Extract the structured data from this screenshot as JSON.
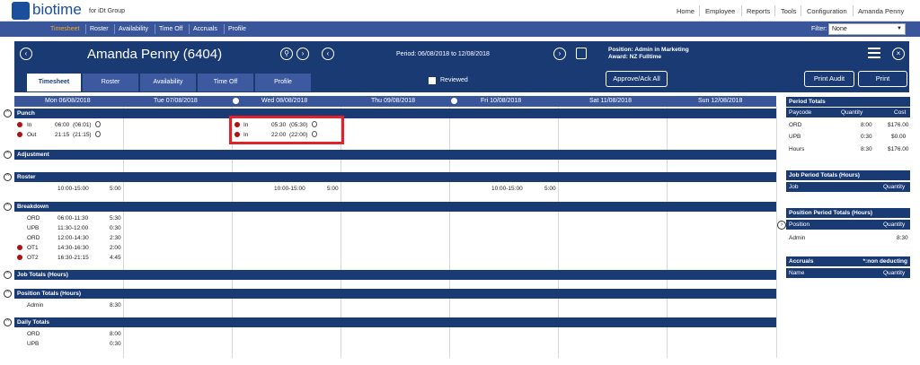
{
  "app": {
    "logo": "biotime",
    "subtitle": "for iDt Group"
  },
  "topnav": [
    "Home",
    "Employee",
    "Reports",
    "Tools",
    "Configuration",
    "Amanda Penny"
  ],
  "menu": [
    "Timesheet",
    "Roster",
    "Availability",
    "Time Off",
    "Accruals",
    "Profile"
  ],
  "filter": {
    "label": "Filter:",
    "value": "None"
  },
  "employee": {
    "name": "Amanda Penny (6404)",
    "period": "Period: 06/08/2018 to 12/08/2018",
    "position": "Position: Admin in Marketing",
    "award": "Award: NZ Fulltime"
  },
  "tabs": [
    "Timesheet",
    "Roster",
    "Availability",
    "Time Off",
    "Profile"
  ],
  "reviewed": "Reviewed",
  "buttons": {
    "approve": "Approve/Ack All",
    "print_audit": "Print Audit",
    "print": "Print"
  },
  "days": [
    "Mon 06/08/2018",
    "Tue 07/08/2018",
    "Wed 08/08/2018",
    "Thu 09/08/2018",
    "Fri 10/08/2018",
    "Sat 11/08/2018",
    "Sun 12/08/2018"
  ],
  "sections": {
    "punch": "Punch",
    "adjustment": "Adjustment",
    "roster": "Roster",
    "breakdown": "Breakdown",
    "job_totals": "Job Totals (Hours)",
    "position_totals": "Position Totals (Hours)",
    "daily_totals": "Daily Totals"
  },
  "punch": {
    "mon": [
      {
        "type": "In",
        "time": "06:00",
        "rounded": "(06:01)"
      },
      {
        "type": "Out",
        "time": "21:15",
        "rounded": "(21:15)"
      }
    ],
    "wed": [
      {
        "type": "In",
        "time": "05:30",
        "rounded": "(05:30)"
      },
      {
        "type": "In",
        "time": "22:00",
        "rounded": "(22:00)"
      }
    ]
  },
  "roster": [
    {
      "range": "10:00-15:00",
      "hours": "5:00"
    },
    {
      "range": "10:00-15:00",
      "hours": "5:00"
    },
    {
      "range": "10:00-15:00",
      "hours": "5:00"
    }
  ],
  "breakdown": [
    {
      "code": "ORD",
      "range": "06:00-11:30",
      "hours": "5:30"
    },
    {
      "code": "UPB",
      "range": "11:30-12:00",
      "hours": "0:30"
    },
    {
      "code": "ORD",
      "range": "12:00-14:30",
      "hours": "2:30"
    },
    {
      "code": "OT1",
      "range": "14:30-16:30",
      "hours": "2:00"
    },
    {
      "code": "OT2",
      "range": "16:30-21:15",
      "hours": "4:45"
    }
  ],
  "position_totals": {
    "name": "Admin",
    "hours": "8:30"
  },
  "daily_totals": [
    {
      "code": "ORD",
      "hours": "8:00"
    },
    {
      "code": "UPB",
      "hours": "0:30"
    }
  ],
  "period_totals": {
    "title": "Period Totals",
    "headers": [
      "Paycode",
      "Quantity",
      "Cost"
    ],
    "rows": [
      [
        "ORD",
        "8:00",
        "$176.00"
      ],
      [
        "UPB",
        "0:30",
        "$0.00"
      ],
      [
        "Hours",
        "8:30",
        "$176.00"
      ]
    ]
  },
  "job_period": {
    "title": "Job Period Totals (Hours)",
    "headers": [
      "Job",
      "Quantity"
    ]
  },
  "position_period": {
    "title": "Position Period Totals (Hours)",
    "headers": [
      "Position",
      "Quantity"
    ],
    "rows": [
      [
        "Admin",
        "8:30"
      ]
    ]
  },
  "accruals": {
    "title": "Accruals",
    "note": "*:non deducting",
    "headers": [
      "Name",
      "Quantity"
    ]
  }
}
